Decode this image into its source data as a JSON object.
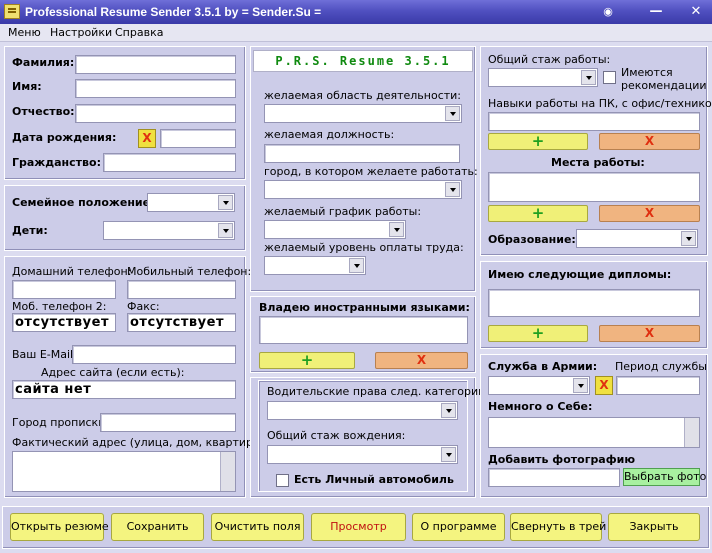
{
  "window": {
    "title": "Professional Resume Sender  3.5.1  by  = Sender.Su ="
  },
  "menu": [
    "Меню",
    "Настройки",
    "Справка"
  ],
  "personal": {
    "surname": "Фамилия:",
    "name": "Имя:",
    "patronymic": "Отчество:",
    "birthdate": "Дата рождения:",
    "citizenship": "Гражданство:",
    "clear_x": "X"
  },
  "family": {
    "status": "Семейное положение:",
    "children": "Дети:"
  },
  "contacts": {
    "home_phone": "Домашний телефон:",
    "mobile_phone": "Мобильный телефон:",
    "mobile2": "Моб. телефон 2:",
    "fax": "Факс:",
    "mobile2_value": "отсутствует",
    "fax_value": "отсутствует",
    "email": "Ваш E-Mail:",
    "site": "Адрес сайта (если есть):",
    "site_value": "сайта нет",
    "city": "Город прописки:",
    "address": "Фактический адрес (улица, дом, квартира):"
  },
  "brand": "P.R.S. Resume 3.5.1",
  "job": {
    "area": "желаемая область деятельности:",
    "position": "желаемая должность:",
    "city": "город, в котором желаете работать:",
    "schedule": "желаемый график работы:",
    "salary": "желаемый уровень оплаты труда:"
  },
  "languages": {
    "label": "Владею иностранными языками:",
    "add": "+",
    "remove": "X"
  },
  "driving": {
    "categories": "Водительские права след. категории:",
    "experience": "Общий стаж вождения:",
    "own_car": "Есть Личный автомобиль"
  },
  "experience": {
    "total": "Общий стаж работы:",
    "recommendations": "Имеются рекомендации",
    "pc_skills": "Навыки работы на ПК, с офис/техникой:",
    "places": "Места работы:",
    "education": "Образование:",
    "add": "+",
    "remove": "X"
  },
  "diplomas": {
    "label": "Имею следующие дипломы:",
    "add": "+",
    "remove": "X"
  },
  "army": {
    "label": "Служба в Армии:",
    "period": "Период службы",
    "about": "Немного о Себе:",
    "photo": "Добавить фотографию",
    "choose_photo": "Выбрать фото",
    "clear_x": "X"
  },
  "buttons": [
    "Открыть резюме",
    "Сохранить",
    "Очистить поля",
    "Просмотр",
    "О программе",
    "Свернуть в трей",
    "Закрыть"
  ],
  "colors": {
    "title_bar": "#4848b8",
    "panel": "#cccce8",
    "brand_text": "#108a10",
    "button_yellow": "#f4f480",
    "button_orange": "#f0b480",
    "preview_text": "#c01010"
  }
}
